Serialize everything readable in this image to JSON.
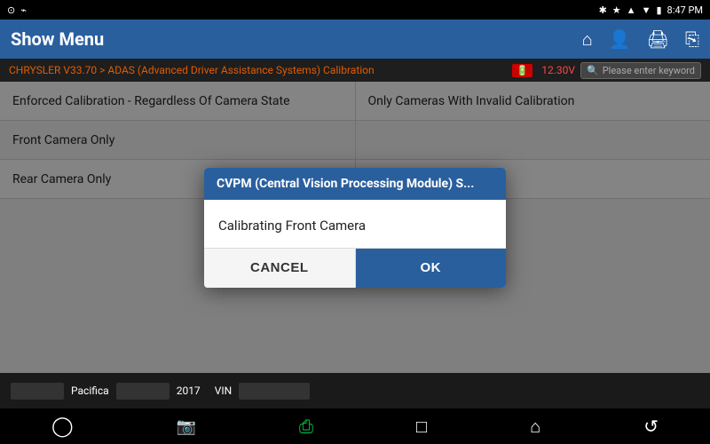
{
  "status_bar": {
    "time": "8:47 PM",
    "icons_left": [
      "android-icon",
      "usb-icon"
    ],
    "icons_right": [
      "bluetooth-icon",
      "settings-icon",
      "signal-icon",
      "wifi-icon",
      "battery-icon"
    ]
  },
  "header": {
    "title": "Show Menu",
    "icons": [
      "home-icon",
      "profile-icon",
      "print-icon",
      "export-icon"
    ]
  },
  "breadcrumb": {
    "text": "CHRYSLER V33.70 > ADAS (Advanced Driver Assistance Systems) Calibration",
    "voltage_label": "12.30V"
  },
  "search": {
    "placeholder": "Please enter keyword"
  },
  "table": {
    "rows": [
      {
        "col1": "Enforced Calibration - Regardless Of Camera State",
        "col2": "Only Cameras With Invalid Calibration"
      },
      {
        "col1": "Front Camera Only",
        "col2": ""
      },
      {
        "col1": "Rear Camera Only",
        "col2": ""
      }
    ]
  },
  "modal": {
    "title": "CVPM (Central Vision Processing Module) S...",
    "body_text": "Calibrating Front Camera",
    "cancel_label": "CANCEL",
    "ok_label": "OK"
  },
  "info_bar": {
    "vehicle": "Pacifica",
    "year": "2017",
    "vin_label": "VIN"
  },
  "nav_bar": {
    "icons": [
      "circle-nav-icon",
      "camera-nav-icon",
      "print-nav-icon",
      "square-nav-icon",
      "home-nav-icon",
      "back-nav-icon"
    ]
  }
}
